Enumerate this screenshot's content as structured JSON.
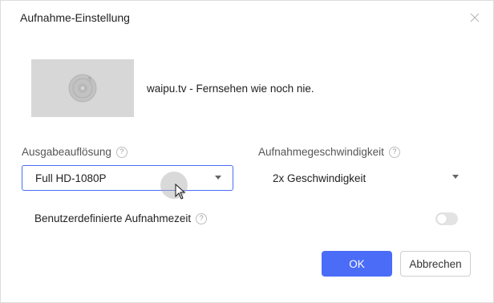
{
  "dialog": {
    "title": "Aufnahme-Einstellung",
    "close_icon": "close-icon"
  },
  "media": {
    "thumbnail_icon": "disc-icon",
    "title": "waipu.tv - Fernsehen wie noch nie."
  },
  "resolution": {
    "label": "Ausgabeauflösung",
    "help": "?",
    "value": "Full HD-1080P"
  },
  "speed": {
    "label": "Aufnahmegeschwindigkeit",
    "help": "?",
    "value": "2x Geschwindigkeit"
  },
  "custom_time": {
    "label": "Benutzerdefinierte Aufnahmezeit",
    "help": "?",
    "enabled": false
  },
  "buttons": {
    "ok": "OK",
    "cancel": "Abbrechen"
  },
  "colors": {
    "accent": "#4a6cf7",
    "toggle_off": "#e3e3e3",
    "thumbnail_bg": "#d7d7d7"
  }
}
